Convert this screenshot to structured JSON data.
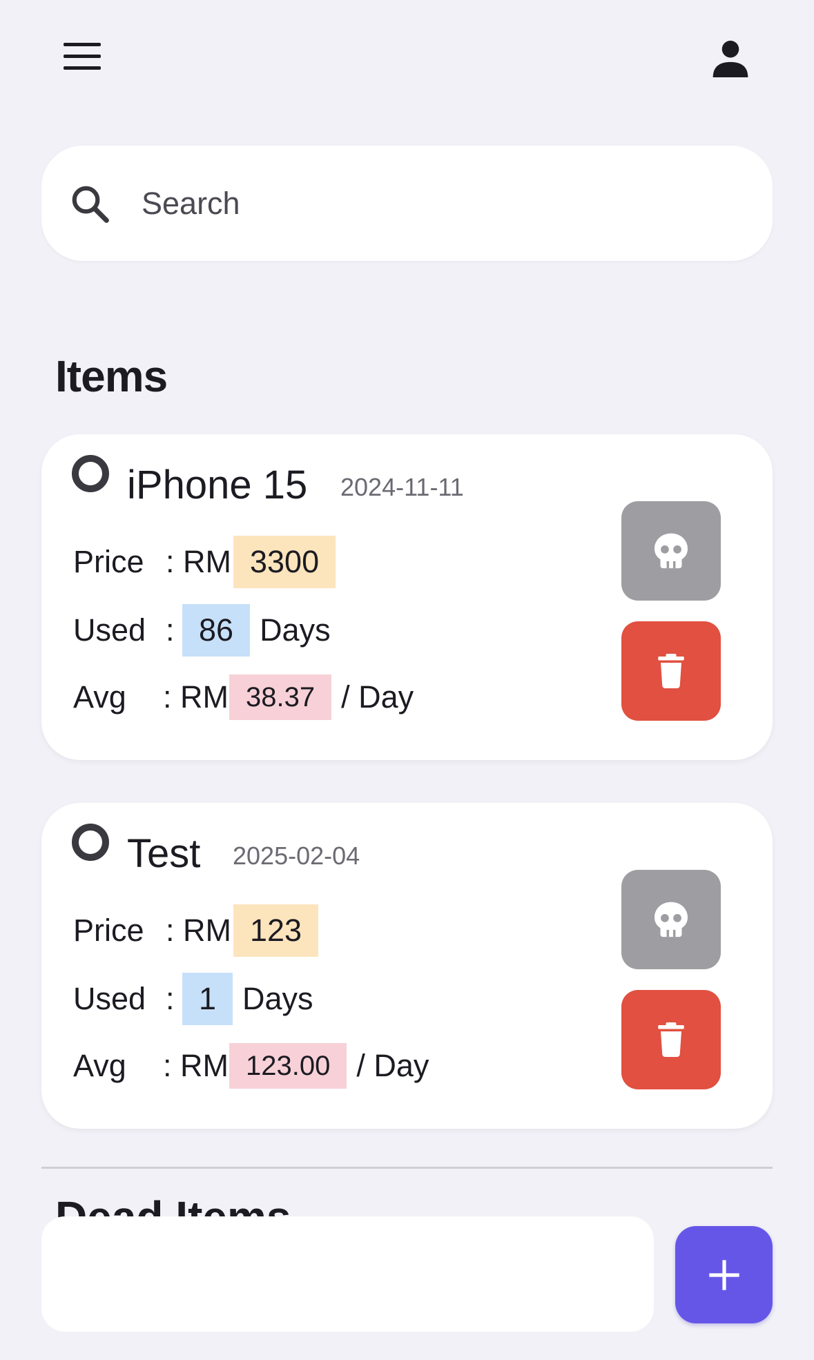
{
  "header": {
    "menu_icon": "hamburger-menu-icon",
    "profile_icon": "person-icon"
  },
  "search": {
    "placeholder": "Search",
    "value": ""
  },
  "items_section": {
    "title": "Items",
    "items": [
      {
        "name": "iPhone 15",
        "date": "2024-11-11",
        "price_label": "Price",
        "price_sep": ": RM",
        "price": "3300",
        "used_label": "Used",
        "used_sep": ":",
        "used_days": "86",
        "days_unit": "Days",
        "avg_label": "Avg",
        "avg_sep": ": RM",
        "avg": "38.37",
        "avg_unit": "/ Day"
      },
      {
        "name": "Test",
        "date": "2025-02-04",
        "price_label": "Price",
        "price_sep": ": RM",
        "price": "123",
        "used_label": "Used",
        "used_sep": ":",
        "used_days": "1",
        "days_unit": "Days",
        "avg_label": "Avg",
        "avg_sep": ": RM",
        "avg": "123.00",
        "avg_unit": "/ Day"
      }
    ]
  },
  "dead_section": {
    "title": "Dead Items"
  },
  "actions": {
    "add_icon": "plus-icon",
    "mark_dead_icon": "skull-icon",
    "delete_icon": "trash-icon"
  },
  "colors": {
    "background": "#f1f1f7",
    "price_highlight": "#fce4bd",
    "used_highlight": "#c7e0fa",
    "avg_highlight": "#f7d1d7",
    "mark_dead_button": "#9e9da2",
    "delete_button": "#e15040",
    "fab": "#6656e8"
  }
}
